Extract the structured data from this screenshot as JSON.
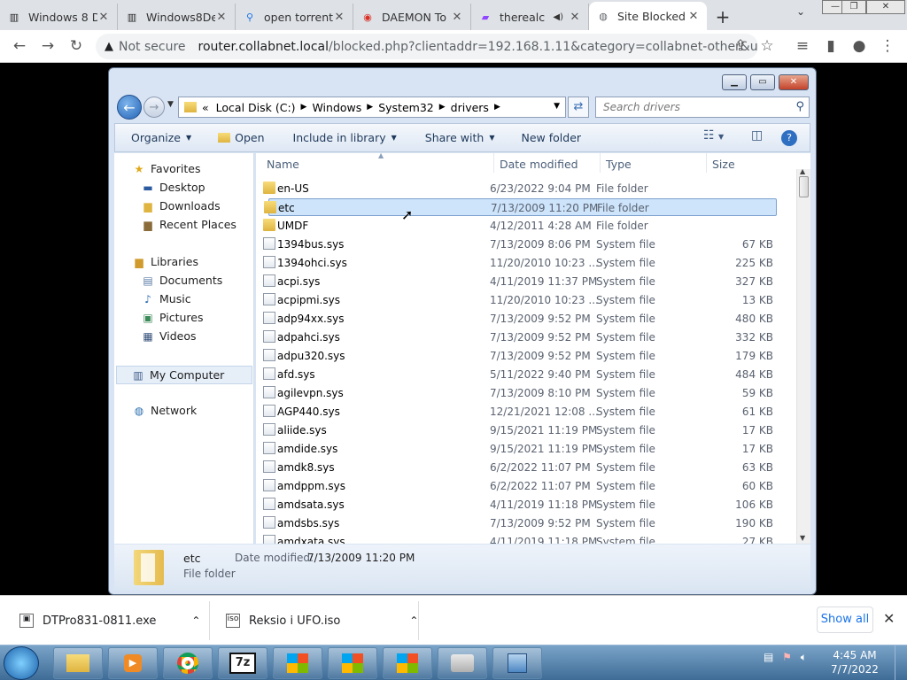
{
  "browser": {
    "tabs": [
      {
        "title": "Windows 8 D",
        "icon": "archive-icon"
      },
      {
        "title": "Windows8De",
        "icon": "archive-icon"
      },
      {
        "title": "open torrent",
        "icon": "search-icon"
      },
      {
        "title": "DAEMON To",
        "icon": "daemon-icon"
      },
      {
        "title": "therealc",
        "icon": "twitch-icon"
      },
      {
        "title": "Site Blocked",
        "icon": "globe-icon"
      }
    ],
    "security_label": "Not secure",
    "url_host": "router.collabnet.local",
    "url_rest": "/blocked.php?clientaddr=192.168.1.11&category=collabnet-other&url=..."
  },
  "explorer": {
    "breadcrumb": [
      "Local Disk (C:)",
      "Windows",
      "System32",
      "drivers"
    ],
    "breadcrumb_prefix": "«",
    "search_placeholder": "Search drivers",
    "commands": {
      "organize": "Organize",
      "open": "Open",
      "include": "Include in library",
      "share": "Share with",
      "newfolder": "New folder"
    },
    "nav": {
      "favorites": "Favorites",
      "desktop": "Desktop",
      "downloads": "Downloads",
      "recent": "Recent Places",
      "libraries": "Libraries",
      "documents": "Documents",
      "music": "Music",
      "pictures": "Pictures",
      "videos": "Videos",
      "computer": "My Computer",
      "network": "Network"
    },
    "columns": {
      "name": "Name",
      "date": "Date modified",
      "type": "Type",
      "size": "Size"
    },
    "files": [
      {
        "name": "en-US",
        "date": "6/23/2022 9:04 PM",
        "type": "File folder",
        "size": "",
        "kind": "folder"
      },
      {
        "name": "etc",
        "date": "7/13/2009 11:20 PM",
        "type": "File folder",
        "size": "",
        "kind": "folder"
      },
      {
        "name": "UMDF",
        "date": "4/12/2011 4:28 AM",
        "type": "File folder",
        "size": "",
        "kind": "folder"
      },
      {
        "name": "1394bus.sys",
        "date": "7/13/2009 8:06 PM",
        "type": "System file",
        "size": "67 KB",
        "kind": "sys"
      },
      {
        "name": "1394ohci.sys",
        "date": "11/20/2010 10:23 ...",
        "type": "System file",
        "size": "225 KB",
        "kind": "sys"
      },
      {
        "name": "acpi.sys",
        "date": "4/11/2019 11:37 PM",
        "type": "System file",
        "size": "327 KB",
        "kind": "sys"
      },
      {
        "name": "acpipmi.sys",
        "date": "11/20/2010 10:23 ...",
        "type": "System file",
        "size": "13 KB",
        "kind": "sys"
      },
      {
        "name": "adp94xx.sys",
        "date": "7/13/2009 9:52 PM",
        "type": "System file",
        "size": "480 KB",
        "kind": "sys"
      },
      {
        "name": "adpahci.sys",
        "date": "7/13/2009 9:52 PM",
        "type": "System file",
        "size": "332 KB",
        "kind": "sys"
      },
      {
        "name": "adpu320.sys",
        "date": "7/13/2009 9:52 PM",
        "type": "System file",
        "size": "179 KB",
        "kind": "sys"
      },
      {
        "name": "afd.sys",
        "date": "5/11/2022 9:40 PM",
        "type": "System file",
        "size": "484 KB",
        "kind": "sys"
      },
      {
        "name": "agilevpn.sys",
        "date": "7/13/2009 8:10 PM",
        "type": "System file",
        "size": "59 KB",
        "kind": "sys"
      },
      {
        "name": "AGP440.sys",
        "date": "12/21/2021 12:08 ...",
        "type": "System file",
        "size": "61 KB",
        "kind": "sys"
      },
      {
        "name": "aliide.sys",
        "date": "9/15/2021 11:19 PM",
        "type": "System file",
        "size": "17 KB",
        "kind": "sys"
      },
      {
        "name": "amdide.sys",
        "date": "9/15/2021 11:19 PM",
        "type": "System file",
        "size": "17 KB",
        "kind": "sys"
      },
      {
        "name": "amdk8.sys",
        "date": "6/2/2022 11:07 PM",
        "type": "System file",
        "size": "63 KB",
        "kind": "sys"
      },
      {
        "name": "amdppm.sys",
        "date": "6/2/2022 11:07 PM",
        "type": "System file",
        "size": "60 KB",
        "kind": "sys"
      },
      {
        "name": "amdsata.sys",
        "date": "4/11/2019 11:18 PM",
        "type": "System file",
        "size": "106 KB",
        "kind": "sys"
      },
      {
        "name": "amdsbs.sys",
        "date": "7/13/2009 9:52 PM",
        "type": "System file",
        "size": "190 KB",
        "kind": "sys"
      },
      {
        "name": "amdxata.sys",
        "date": "4/11/2019 11:18 PM",
        "type": "System file",
        "size": "27 KB",
        "kind": "sys"
      }
    ],
    "selected_index": 1,
    "details": {
      "name": "etc",
      "date_label": "Date modified:",
      "date_value": "7/13/2009 11:20 PM",
      "type": "File folder"
    }
  },
  "downloads": [
    {
      "name": "DTPro831-0811.exe"
    },
    {
      "name": "Reksio i UFO.iso"
    }
  ],
  "downloads_show_all": "Show all",
  "taskbar": {
    "app_7z": "7z",
    "time": "4:45 AM",
    "date": "7/7/2022"
  }
}
